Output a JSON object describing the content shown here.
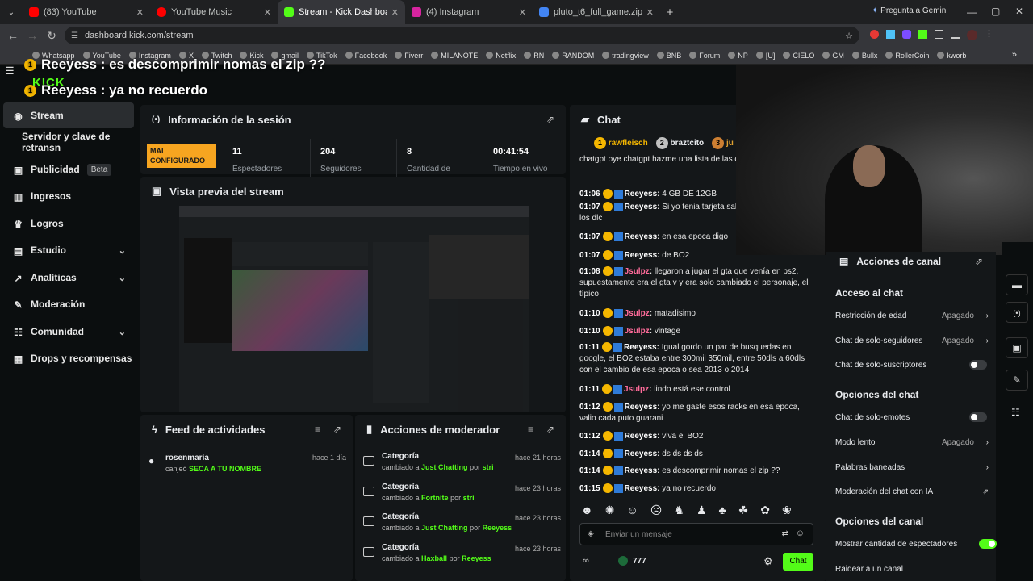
{
  "browser": {
    "tabs": [
      {
        "title": "(83) YouTube",
        "color": "#ff0000"
      },
      {
        "title": "YouTube Music",
        "color": "#ff0000"
      },
      {
        "title": "Stream - Kick Dashboard",
        "color": "#53fc18"
      },
      {
        "title": "(4) Instagram",
        "color": "#d6249f"
      },
      {
        "title": "pluto_t6_full_game.zip - Google",
        "color": "#4285f4"
      }
    ],
    "gemini": "Pregunta a Gemini",
    "url": "dashboard.kick.com/stream",
    "bookmarks": [
      "Whatsapp",
      "YouTube",
      "Instagram",
      "X",
      "Twitch",
      "Kick",
      "gmail",
      "TikTok",
      "Facebook",
      "Fiverr",
      "MILANOTE",
      "Netflix",
      "RN",
      "RANDOM",
      "tradingview",
      "BNB",
      "Forum",
      "NP",
      "[U]",
      "CIELO",
      "GM",
      "Bullx",
      "RollerCoin",
      "kworb"
    ]
  },
  "overlay": {
    "line1": "Reeyess : es descomprimir nomas el zip ??",
    "line2": "Reeyess : ya no recuerdo",
    "logo": "KICK"
  },
  "sidebar": {
    "items": [
      {
        "label": "Stream"
      },
      {
        "label": "Servidor y clave de retransn"
      },
      {
        "label": "Publicidad",
        "badge": "Beta"
      },
      {
        "label": "Ingresos"
      },
      {
        "label": "Logros"
      },
      {
        "label": "Estudio"
      },
      {
        "label": "Analíticas"
      },
      {
        "label": "Moderación"
      },
      {
        "label": "Comunidad"
      },
      {
        "label": "Drops y recompensas"
      }
    ]
  },
  "session": {
    "title": "Información de la sesión",
    "status": "MAL CONFIGURADO",
    "stats": [
      {
        "value": "11",
        "label": "Espectadores"
      },
      {
        "value": "204",
        "label": "Seguidores"
      },
      {
        "value": "8",
        "label": "Cantidad de"
      },
      {
        "value": "00:41:54",
        "label": "Tiempo en vivo"
      }
    ]
  },
  "preview": {
    "title": "Vista previa del stream"
  },
  "feed": {
    "title": "Feed de actividades",
    "items": [
      {
        "user": "rosenmaria",
        "action": "canjeó",
        "reward": "SECA A TU NOMBRE",
        "time": "hace 1 día"
      }
    ]
  },
  "modactions": {
    "title": "Acciones de moderador",
    "rows": [
      {
        "title": "Categoría",
        "changed": "cambiado a",
        "cat": "Just Chatting",
        "por": "por",
        "user": "stri",
        "time": "hace 21 horas"
      },
      {
        "title": "Categoría",
        "changed": "cambiado a",
        "cat": "Fortnite",
        "por": "por",
        "user": "stri",
        "time": "hace 23 horas"
      },
      {
        "title": "Categoría",
        "changed": "cambiado a",
        "cat": "Just Chatting",
        "por": "por",
        "user": "Reeyess",
        "time": "hace 23 horas"
      },
      {
        "title": "Categoría",
        "changed": "cambiado a",
        "cat": "Haxball",
        "por": "por",
        "user": "Reeyess",
        "time": "hace 23 horas"
      }
    ]
  },
  "chat": {
    "title": "Chat",
    "top": [
      "rawfleisch",
      "braztcito",
      "ju"
    ],
    "messages": [
      {
        "time": "",
        "user": "",
        "text": "chatgpt oye chatgpt hazme una lista de las c para mi primer pc"
      },
      {
        "time": "01:06",
        "user": "Reeyess",
        "text": "4 GB DE 12GB"
      },
      {
        "time": "01:07",
        "user": "Reeyess",
        "text": "Si yo tenia tarjeta sabes como compraba los dlc"
      },
      {
        "time": "01:07",
        "user": "Reeyess",
        "text": "en esa epoca digo"
      },
      {
        "time": "01:07",
        "user": "Reeyess",
        "text": "de BO2"
      },
      {
        "time": "01:08",
        "user": "Jsulpz",
        "text": "llegaron a jugar el gta que venía en ps2, supuestamente era el gta v y era solo cambiado el personaje, el típico"
      },
      {
        "time": "01:10",
        "user": "Jsulpz",
        "text": "matadisimo"
      },
      {
        "time": "01:10",
        "user": "Jsulpz",
        "text": "vintage"
      },
      {
        "time": "01:11",
        "user": "Reeyess",
        "text": "Igual gordo un par de busquedas en google, el BO2 estaba entre 300mil 350mil, entre 50dls a 60dls con el cambio de esa epoca o sea 2013 o 2014"
      },
      {
        "time": "01:11",
        "user": "Jsulpz",
        "text": "lindo está ese control"
      },
      {
        "time": "01:12",
        "user": "Reeyess",
        "text": "yo me gaste esos racks en esa epoca, valio cada puto guarani"
      },
      {
        "time": "01:12",
        "user": "Reeyess",
        "text": "viva el BO2"
      },
      {
        "time": "01:14",
        "user": "Reeyess",
        "text": "ds ds ds ds"
      },
      {
        "time": "01:14",
        "user": "Reeyess",
        "text": "es descomprimir nomas el zip ??"
      },
      {
        "time": "01:15",
        "user": "Reeyess",
        "text": "ya no recuerdo"
      }
    ],
    "placeholder": "Enviar un mensaje",
    "points": "777",
    "send": "Chat"
  },
  "actions": {
    "title": "Acciones de canal",
    "sec1": "Acceso al chat",
    "r1": [
      {
        "label": "Restricción de edad",
        "value": "Apagado"
      },
      {
        "label": "Chat de solo-seguidores",
        "value": "Apagado"
      },
      {
        "label": "Chat de solo-suscriptores",
        "value": ""
      }
    ],
    "sec2": "Opciones del chat",
    "r2": [
      {
        "label": "Chat de solo-emotes",
        "value": ""
      },
      {
        "label": "Modo lento",
        "value": "Apagado"
      },
      {
        "label": "Palabras baneadas",
        "value": ""
      },
      {
        "label": "Moderación del chat con IA",
        "value": ""
      }
    ],
    "sec3": "Opciones del canal",
    "r3": [
      {
        "label": "Mostrar cantidad de espectadores",
        "value": ""
      },
      {
        "label": "Raidear a un canal",
        "value": ""
      }
    ]
  },
  "colors": {
    "accent": "#53fc18",
    "warning": "#f7a520",
    "panel": "#141719"
  }
}
